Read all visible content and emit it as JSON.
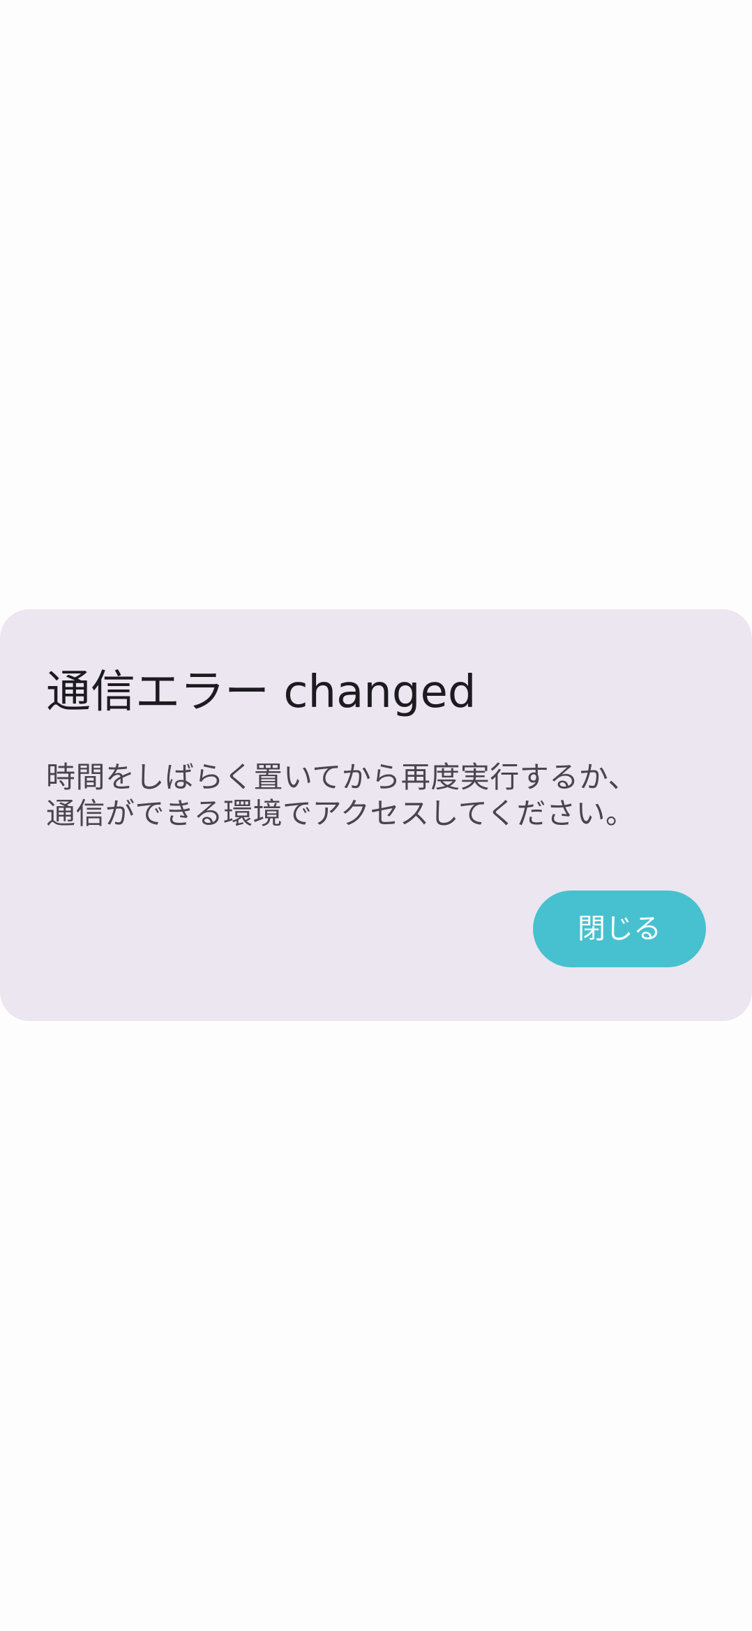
{
  "dialog": {
    "title": "通信エラー changed",
    "body_lines": [
      "時間をしばらく置いてから再度実行するか、",
      "通信ができる環境でアクセスしてください。"
    ],
    "close_button_label": "閉じる"
  },
  "colors": {
    "background": "#fdfdfd",
    "dialog_surface": "#ece6f0",
    "title_text": "#1d1b20",
    "body_text": "#49454f",
    "button_fill": "#47c1cf",
    "button_text": "#ffffff"
  }
}
